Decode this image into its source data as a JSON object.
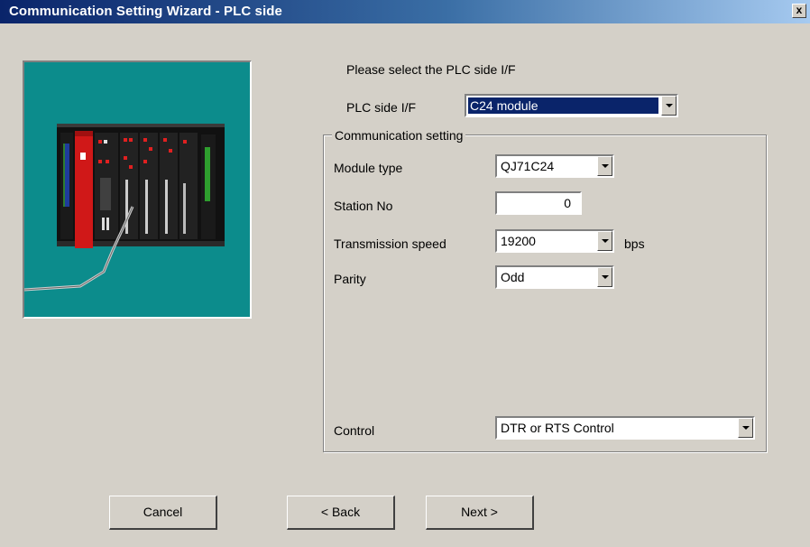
{
  "window": {
    "title": "Communication Setting Wizard - PLC side",
    "close_glyph": "x"
  },
  "prompt": "Please select the PLC side I/F",
  "plc_side_if": {
    "label": "PLC side I/F",
    "value": "C24 module"
  },
  "communication_setting": {
    "legend": "Communication setting",
    "module_type": {
      "label": "Module type",
      "value": "QJ71C24"
    },
    "station_no": {
      "label": "Station No",
      "value": "0"
    },
    "transmission_speed": {
      "label": "Transmission speed",
      "value": "19200",
      "unit": "bps"
    },
    "parity": {
      "label": "Parity",
      "value": "Odd"
    },
    "control": {
      "label": "Control",
      "value": "DTR or RTS Control"
    }
  },
  "buttons": {
    "cancel": "Cancel",
    "back": "< Back",
    "next": "Next >"
  },
  "colors": {
    "title_bar_start": "#0a246a",
    "title_bar_end": "#a6caf0",
    "dialog_background": "#d4d0c8",
    "picture_background": "#0c8c8c",
    "selection_highlight": "#0a246a"
  },
  "icons": {
    "wizard_picture": "plc-rack-illustration",
    "close": "close-icon",
    "dropdown": "chevron-down-icon"
  }
}
